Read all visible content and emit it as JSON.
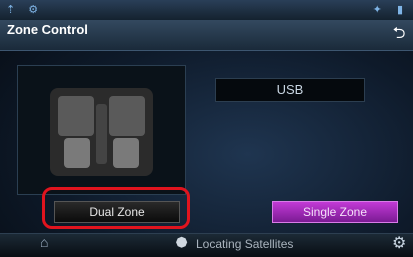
{
  "status": {
    "left_icons": "⇡ ⚙",
    "right_icons": "✦ ▮"
  },
  "header": {
    "title": "Zone Control"
  },
  "source": {
    "label": "USB"
  },
  "buttons": {
    "dual_zone": "Dual Zone",
    "single_zone": "Single Zone"
  },
  "footer": {
    "status_text": "Locating Satellites"
  },
  "icons": {
    "back": "back-arrow-icon",
    "home": "home-icon",
    "satellite": "satellite-icon",
    "settings": "gear-icon"
  },
  "colors": {
    "accent_purple": "#a02ebf",
    "highlight_red": "#e0141e"
  }
}
